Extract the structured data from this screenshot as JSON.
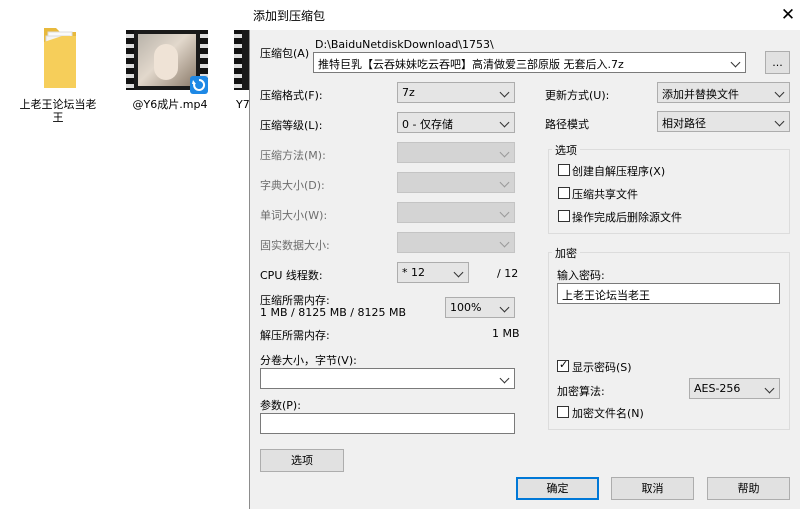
{
  "desktop": {
    "folder": {
      "label": "上老王论坛当老\n王",
      "icon": "folder-icon"
    },
    "video1": {
      "label": "@Y6成片.mp4",
      "icon": "video-thumbnail",
      "badge": "sync-badge-icon"
    },
    "video2": {
      "label": "Y7"
    }
  },
  "dialog": {
    "title": "添加到压缩包",
    "close": "✕",
    "archive": {
      "label": "压缩包(A)",
      "folder_path": "D:\\BaiduNetdiskDownload\\1753\\",
      "filename": "推特巨乳【云吞妹妹吃云吞吧】高清做爱三部原版 无套后入.7z",
      "browse_label": "..."
    },
    "left": {
      "format_label": "压缩格式(F):",
      "format_value": "7z",
      "level_label": "压缩等级(L):",
      "level_value": "0 - 仅存储",
      "method_label": "压缩方法(M):",
      "dict_label": "字典大小(D):",
      "word_label": "单词大小(W):",
      "solid_label": "固实数据大小:",
      "cpu_label": "CPU 线程数:",
      "cpu_value": "* 12",
      "cpu_total": "/ 12",
      "mem_label": "压缩所需内存:",
      "mem_detail": "1 MB / 8125 MB / 8125 MB",
      "mem_percent": "100%",
      "decomp_label": "解压所需内存:",
      "decomp_value": "1 MB",
      "split_label": "分卷大小，字节(V):",
      "split_value": "",
      "params_label": "参数(P):",
      "params_value": "",
      "options_button": "选项"
    },
    "right": {
      "update_label": "更新方式(U):",
      "update_value": "添加并替换文件",
      "path_label": "路径模式",
      "path_value": "相对路径",
      "options_group": "选项",
      "opt_sfx": "创建自解压程序(X)",
      "opt_shared": "压缩共享文件",
      "opt_delete": "操作完成后删除源文件",
      "encrypt_group": "加密",
      "password_label": "输入密码:",
      "password_value": "上老王论坛当老王",
      "show_password": "显示密码(S)",
      "method_label": "加密算法:",
      "method_value": "AES-256",
      "encrypt_names": "加密文件名(N)"
    },
    "buttons": {
      "ok": "确定",
      "cancel": "取消",
      "help": "帮助"
    }
  },
  "colors": {
    "accent": "#0078d7",
    "dialog_bg": "#f0f0f0"
  }
}
